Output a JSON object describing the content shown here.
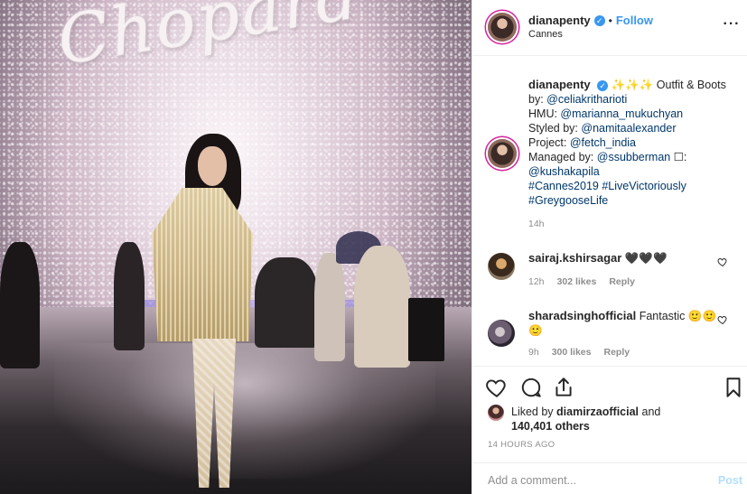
{
  "post": {
    "image_brand_text": "Chopard",
    "owner": {
      "username": "dianapenty",
      "verified_mark": "✓",
      "follow_label": "Follow",
      "separator": "•",
      "location": "Cannes"
    },
    "more_label": "···",
    "caption": {
      "username": "dianapenty",
      "emoji": "✨✨✨",
      "line1_rest": " Outfit & Boots",
      "line2_prefix": "by: ",
      "line2_link": "@celiakritharioti",
      "line3_prefix": "HMU: ",
      "line3_link": "@marianna_mukuchyan",
      "line4_prefix": "Styled by: ",
      "line4_link": "@namitaalexander",
      "line5_prefix": "Project: ",
      "line5_link": "@fetch_india",
      "line6_prefix": "Managed by: ",
      "line6_link": "@ssubberman",
      "line6_suffix": " ☐:",
      "line7_link": "@kushakapila",
      "line8_link1": "#Cannes2019",
      "line8_link2": "#LiveVictoriously",
      "line9_link": "#GreygooseLife",
      "time": "14h"
    },
    "comments": [
      {
        "username": "sairaj.kshirsagar",
        "text": "🖤🖤🖤",
        "time": "12h",
        "likes": "302 likes",
        "reply": "Reply"
      },
      {
        "username": "sharadsinghofficial",
        "text": "Fantastic 🙂🙂🙂",
        "time": "9h",
        "likes": "300 likes",
        "reply": "Reply"
      }
    ],
    "likes": {
      "prefix": "Liked by ",
      "user": "diamirzaofficial",
      "mid": " and",
      "count": "140,401 others"
    },
    "timestamp": "14 HOURS AGO",
    "add_comment": {
      "placeholder": "Add a comment...",
      "post_label": "Post"
    },
    "colors": {
      "accent": "#3897f0",
      "link": "#00376b",
      "muted": "#8e8e8e",
      "post_disabled": "#b2dffc"
    }
  }
}
